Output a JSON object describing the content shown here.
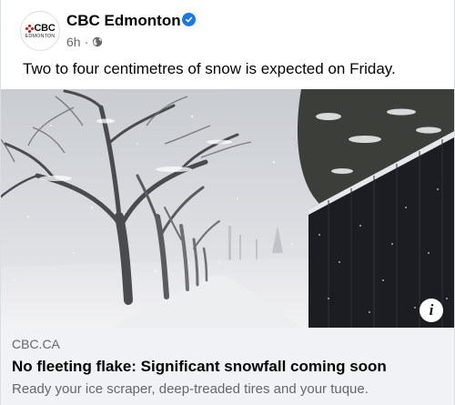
{
  "post": {
    "page_name": "CBC Edmonton",
    "avatar": {
      "logo_text": "CBC",
      "logo_sub": "EDMONTON"
    },
    "time": "6h",
    "separator": "·",
    "text": "Two to four centimetres of snow is expected on Friday."
  },
  "link_preview": {
    "domain": "CBC.CA",
    "headline": "No fleeting flake: Significant snowfall coming soon",
    "description": "Ready your ice scraper, deep-treaded tires and your tuque.",
    "info_glyph": "i"
  },
  "colors": {
    "verified": "#1877f2",
    "link_box_bg": "#f0f2f5",
    "meta_text": "#65676b",
    "logo_red": "#e60505"
  },
  "icons": [
    "verified-badge-icon",
    "globe-icon",
    "info-icon"
  ]
}
